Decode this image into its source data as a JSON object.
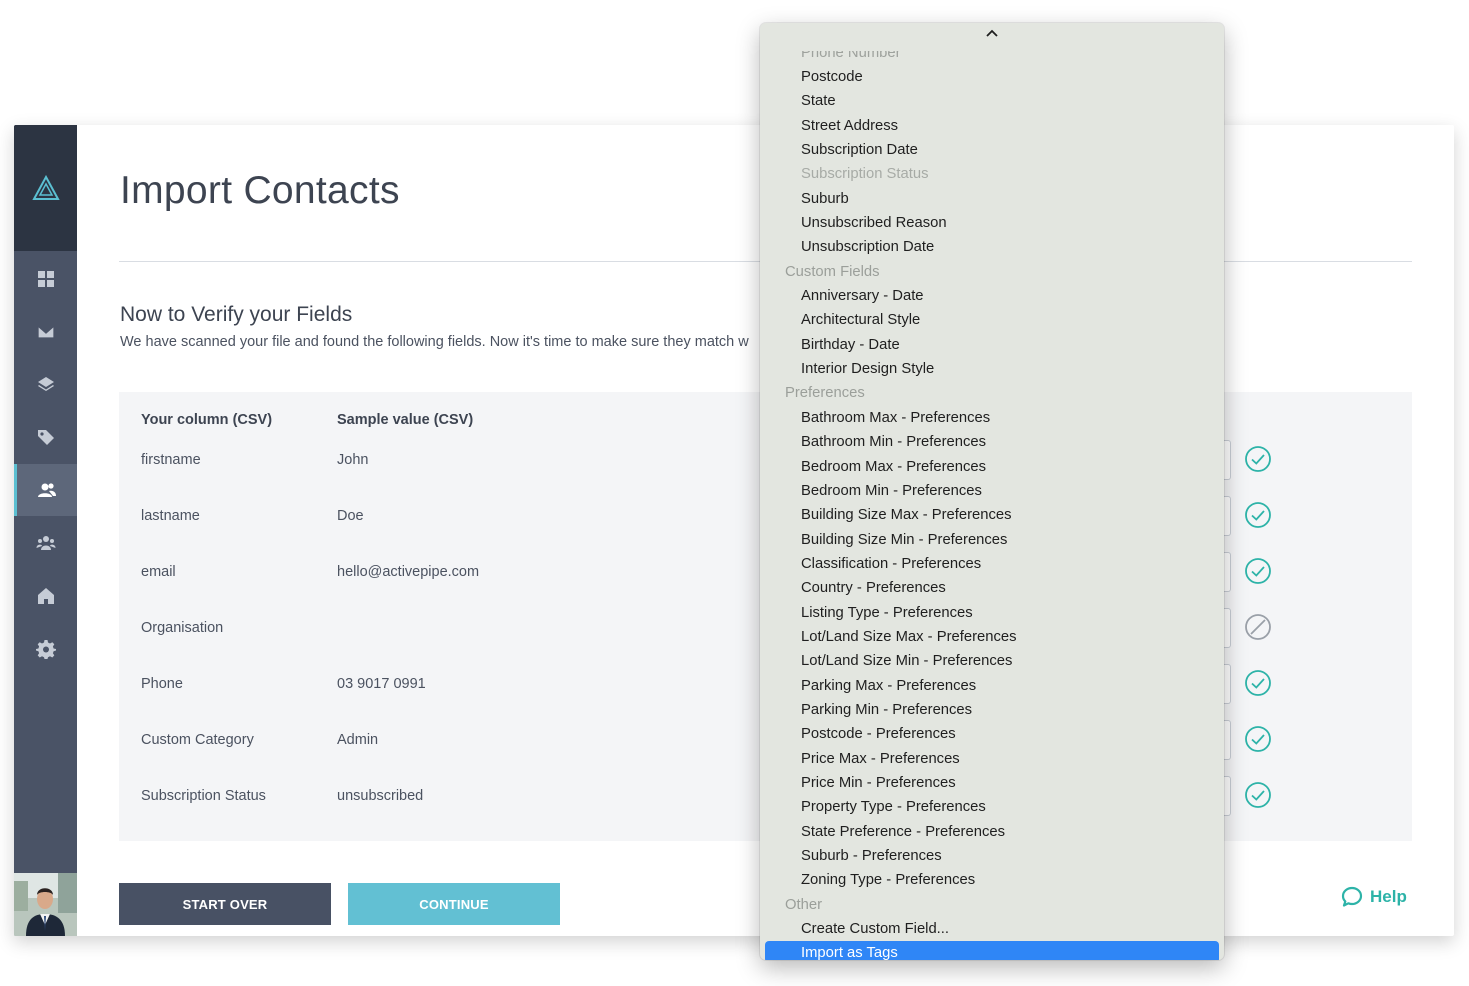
{
  "page": {
    "title": "Import Contacts",
    "subtitle": "Now to Verify your Fields",
    "description": "We have scanned your file and found the following fields. Now it's time to make sure they match w"
  },
  "table": {
    "headers": [
      "Your column (CSV)",
      "Sample value (CSV)"
    ],
    "rows": [
      {
        "column": "firstname",
        "sample": "John",
        "status": "matched"
      },
      {
        "column": "lastname",
        "sample": "Doe",
        "status": "matched"
      },
      {
        "column": "email",
        "sample": "hello@activepipe.com",
        "status": "matched"
      },
      {
        "column": "Organisation",
        "sample": "",
        "status": "skipped"
      },
      {
        "column": "Phone",
        "sample": "03 9017 0991",
        "status": "matched"
      },
      {
        "column": "Custom Category",
        "sample": "Admin",
        "status": "matched"
      },
      {
        "column": "Subscription Status",
        "sample": "unsubscribed",
        "status": "matched"
      }
    ]
  },
  "buttons": {
    "start_over": "START OVER",
    "continue": "CONTINUE"
  },
  "help": {
    "label": "Help"
  },
  "sidebar": {
    "items": [
      {
        "name": "dashboard",
        "icon": "grid-icon"
      },
      {
        "name": "mail",
        "icon": "envelope-icon"
      },
      {
        "name": "layers",
        "icon": "layers-icon"
      },
      {
        "name": "tags",
        "icon": "tag-icon"
      },
      {
        "name": "contacts",
        "icon": "contacts-icon",
        "active": true
      },
      {
        "name": "team",
        "icon": "team-icon"
      },
      {
        "name": "properties",
        "icon": "house-icon"
      },
      {
        "name": "settings",
        "icon": "gear-icon"
      }
    ]
  },
  "dropdown": {
    "clipped_item": "Phone Number",
    "items": [
      {
        "label": "Postcode",
        "kind": "item"
      },
      {
        "label": "State",
        "kind": "item"
      },
      {
        "label": "Street Address",
        "kind": "item"
      },
      {
        "label": "Subscription Date",
        "kind": "item"
      },
      {
        "label": "Subscription Status",
        "kind": "disabled"
      },
      {
        "label": "Suburb",
        "kind": "item"
      },
      {
        "label": "Unsubscribed Reason",
        "kind": "item"
      },
      {
        "label": "Unsubscription Date",
        "kind": "item"
      },
      {
        "label": "Custom Fields",
        "kind": "group"
      },
      {
        "label": "Anniversary - Date",
        "kind": "item"
      },
      {
        "label": "Architectural Style",
        "kind": "item"
      },
      {
        "label": "Birthday - Date",
        "kind": "item"
      },
      {
        "label": "Interior Design Style",
        "kind": "item"
      },
      {
        "label": "Preferences",
        "kind": "group"
      },
      {
        "label": "Bathroom Max - Preferences",
        "kind": "item"
      },
      {
        "label": "Bathroom Min - Preferences",
        "kind": "item"
      },
      {
        "label": "Bedroom Max - Preferences",
        "kind": "item"
      },
      {
        "label": "Bedroom Min - Preferences",
        "kind": "item"
      },
      {
        "label": "Building Size Max - Preferences",
        "kind": "item"
      },
      {
        "label": "Building Size Min - Preferences",
        "kind": "item"
      },
      {
        "label": "Classification - Preferences",
        "kind": "item"
      },
      {
        "label": "Country - Preferences",
        "kind": "item"
      },
      {
        "label": "Listing Type - Preferences",
        "kind": "item"
      },
      {
        "label": "Lot/Land Size Max - Preferences",
        "kind": "item"
      },
      {
        "label": "Lot/Land Size Min - Preferences",
        "kind": "item"
      },
      {
        "label": "Parking Max - Preferences",
        "kind": "item"
      },
      {
        "label": "Parking Min - Preferences",
        "kind": "item"
      },
      {
        "label": "Postcode - Preferences",
        "kind": "item"
      },
      {
        "label": "Price Max - Preferences",
        "kind": "item"
      },
      {
        "label": "Price Min - Preferences",
        "kind": "item"
      },
      {
        "label": "Property Type - Preferences",
        "kind": "item"
      },
      {
        "label": "State Preference - Preferences",
        "kind": "item"
      },
      {
        "label": "Suburb - Preferences",
        "kind": "item"
      },
      {
        "label": "Zoning Type - Preferences",
        "kind": "item"
      },
      {
        "label": "Other",
        "kind": "group"
      },
      {
        "label": "Create Custom Field...",
        "kind": "item"
      },
      {
        "label": "Import as Tags",
        "kind": "selected"
      }
    ]
  },
  "colors": {
    "sidebar": "#4a5366",
    "sidebar_top": "#2c3442",
    "accent": "#62c0d3",
    "match_green": "#2db3a8",
    "selection_blue": "#2f86f6"
  }
}
